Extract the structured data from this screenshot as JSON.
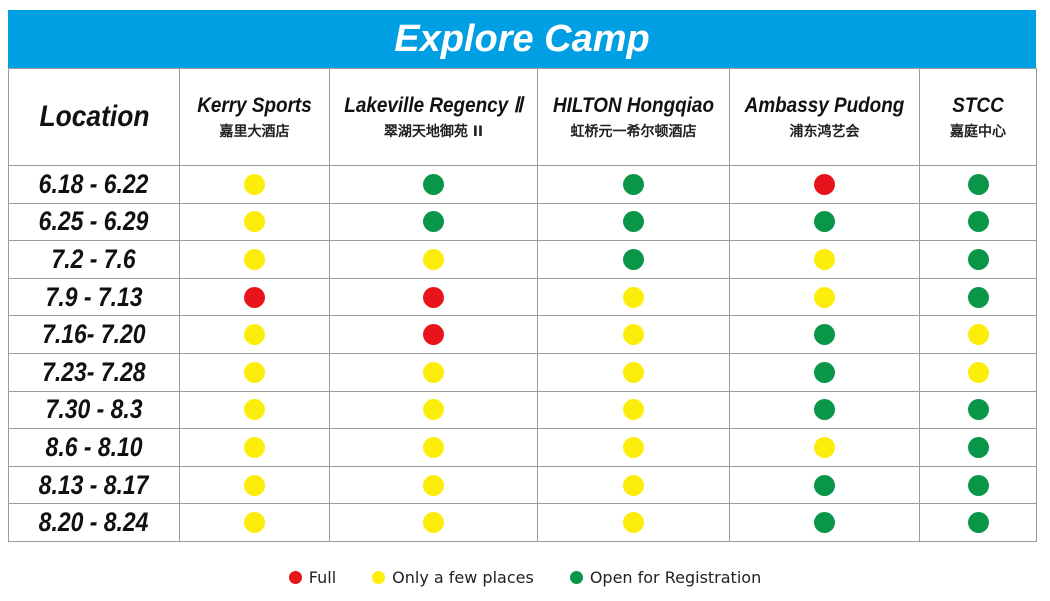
{
  "title": "Explore Camp",
  "header": {
    "location_label": "Location",
    "venues": [
      {
        "en": "Kerry Sports",
        "cn": "嘉里大酒店"
      },
      {
        "en": "Lakeville Regency Ⅱ",
        "cn": "翠湖天地御苑 II"
      },
      {
        "en": "HILTON Hongqiao",
        "cn": "虹桥元一希尔顿酒店"
      },
      {
        "en": "Ambassy Pudong",
        "cn": "浦东鸿艺会"
      },
      {
        "en": "STCC",
        "cn": "嘉庭中心"
      }
    ]
  },
  "rows": [
    {
      "date": "6.18 - 6.22",
      "status": [
        "few",
        "open",
        "open",
        "full",
        "open"
      ]
    },
    {
      "date": "6.25 - 6.29",
      "status": [
        "few",
        "open",
        "open",
        "open",
        "open"
      ]
    },
    {
      "date": "7.2 - 7.6",
      "status": [
        "few",
        "few",
        "open",
        "few",
        "open"
      ]
    },
    {
      "date": "7.9 - 7.13",
      "status": [
        "full",
        "full",
        "few",
        "few",
        "open"
      ]
    },
    {
      "date": "7.16- 7.20",
      "status": [
        "few",
        "full",
        "few",
        "open",
        "few"
      ]
    },
    {
      "date": "7.23- 7.28",
      "status": [
        "few",
        "few",
        "few",
        "open",
        "few"
      ]
    },
    {
      "date": "7.30 - 8.3",
      "status": [
        "few",
        "few",
        "few",
        "open",
        "open"
      ]
    },
    {
      "date": "8.6 - 8.10",
      "status": [
        "few",
        "few",
        "few",
        "few",
        "open"
      ]
    },
    {
      "date": "8.13 - 8.17",
      "status": [
        "few",
        "few",
        "few",
        "open",
        "open"
      ]
    },
    {
      "date": "8.20 - 8.24",
      "status": [
        "few",
        "few",
        "few",
        "open",
        "open"
      ]
    }
  ],
  "legend": [
    {
      "key": "full",
      "label": "Full",
      "color": "#e8141b"
    },
    {
      "key": "few",
      "label": "Only a few places",
      "color": "#fcee0a"
    },
    {
      "key": "open",
      "label": "Open for Registration",
      "color": "#0a9648"
    }
  ]
}
